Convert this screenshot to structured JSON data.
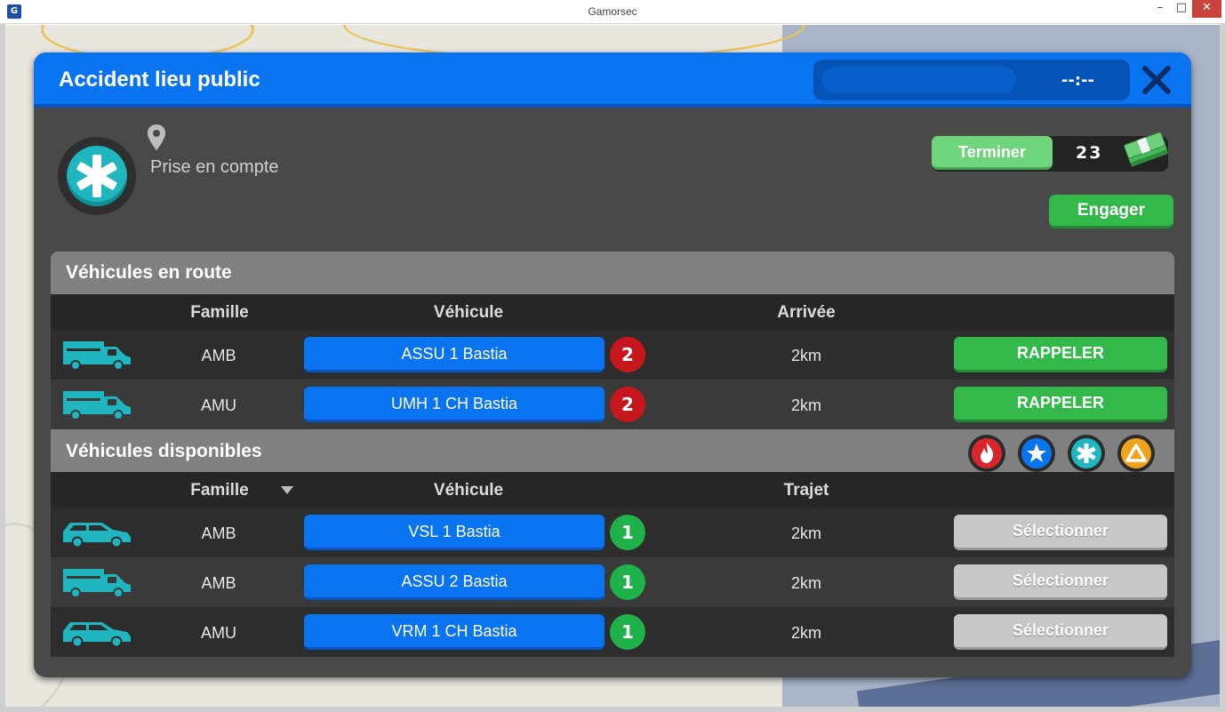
{
  "window": {
    "title": "Gamorsec",
    "min_label": "–",
    "max_label": "□",
    "close_label": "✕"
  },
  "colors": {
    "header_blue": "#0a74f0",
    "green": "#33b84a",
    "red_badge": "#c8161d",
    "green_badge": "#1fb24a",
    "teal": "#1fb6c0"
  },
  "modal": {
    "title": "Accident lieu public",
    "timer": "--:--",
    "status": "Prise en compte",
    "terminer_label": "Terminer",
    "money": "23",
    "engager_label": "Engager"
  },
  "en_route": {
    "title": "Véhicules en route",
    "headers": {
      "famille": "Famille",
      "vehicule": "Véhicule",
      "col3": "Arrivée"
    },
    "rows": [
      {
        "icon": "ambulance-truck-icon",
        "famille": "AMB",
        "vehicule": "ASSU 1 Bastia",
        "badge": "2",
        "distance": "2km",
        "action": "RAPPELER"
      },
      {
        "icon": "ambulance-truck-icon",
        "famille": "AMU",
        "vehicule": "UMH 1 CH Bastia",
        "badge": "2",
        "distance": "2km",
        "action": "RAPPELER"
      }
    ]
  },
  "disponibles": {
    "title": "Véhicules disponibles",
    "filters": [
      "fire-filter-icon",
      "police-star-filter-icon",
      "medical-filter-icon",
      "hazard-triangle-filter-icon"
    ],
    "headers": {
      "famille": "Famille",
      "vehicule": "Véhicule",
      "col3": "Trajet"
    },
    "rows": [
      {
        "icon": "medical-car-icon",
        "famille": "AMB",
        "vehicule": "VSL 1 Bastia",
        "badge": "1",
        "distance": "2km",
        "action": "Sélectionner"
      },
      {
        "icon": "ambulance-truck-icon",
        "famille": "AMB",
        "vehicule": "ASSU 2 Bastia",
        "badge": "1",
        "distance": "2km",
        "action": "Sélectionner"
      },
      {
        "icon": "medical-car-icon",
        "famille": "AMU",
        "vehicule": "VRM 1 CH Bastia",
        "badge": "1",
        "distance": "2km",
        "action": "Sélectionner"
      }
    ]
  }
}
